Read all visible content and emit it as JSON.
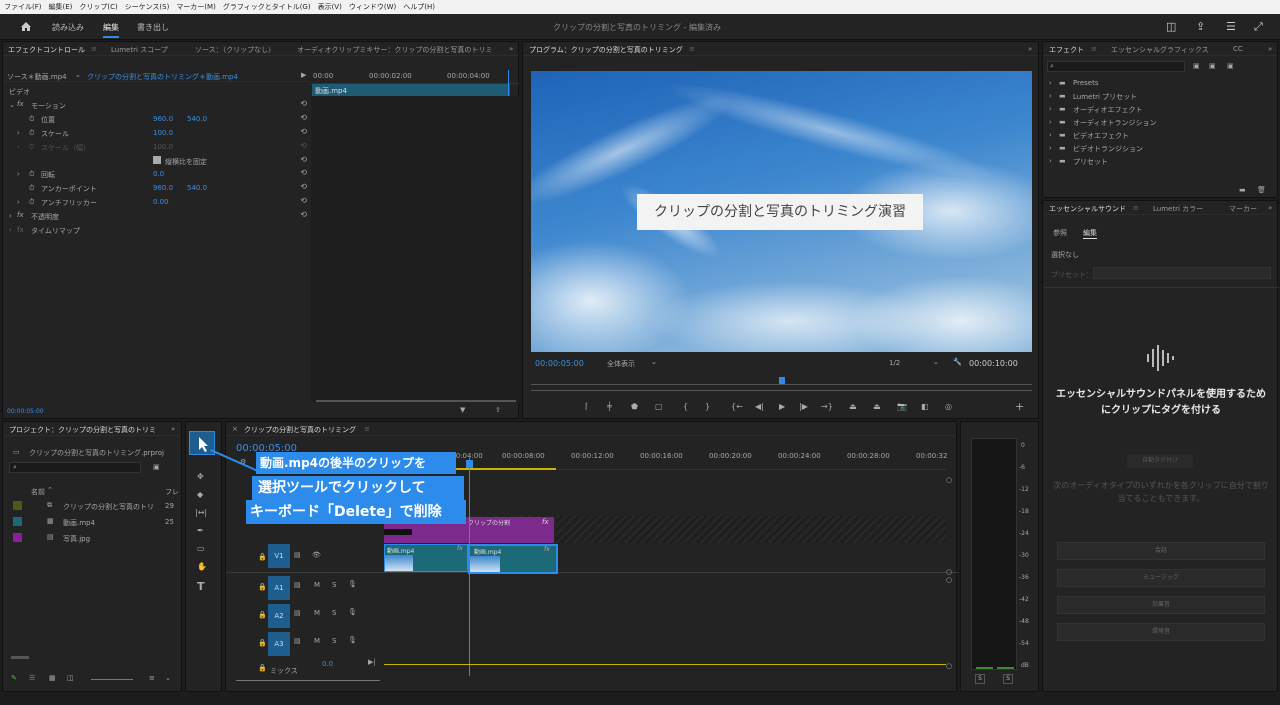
{
  "menu": [
    "ファイル(F)",
    "編集(E)",
    "クリップ(C)",
    "シーケンス(S)",
    "マーカー(M)",
    "グラフィックとタイトル(G)",
    "表示(V)",
    "ウィンドウ(W)",
    "ヘルプ(H)"
  ],
  "workspaces": {
    "home_icon": "home-icon",
    "import": "読み込み",
    "edit": "編集",
    "export": "書き出し"
  },
  "window_title": "クリップの分割と写真のトリミング - 編集済み",
  "effect_controls": {
    "tabs": [
      "エフェクトコントロール",
      "Lumetri スコープ",
      "ソース：（クリップなし）",
      "オーディオクリップミキサー：クリップの分割と写真のトリミ"
    ],
    "source_row": "ソース＊動画.mp4",
    "sequence_row": "クリップの分割と写真のトリミング＊動画.mp4",
    "video_label": "ビデオ",
    "ruler": [
      "00:00",
      "00:00:02:00",
      "00:00:04:00"
    ],
    "clip_label": "動画.mp4",
    "motion": "モーション",
    "position_label": "位置",
    "position_x": "960.0",
    "position_y": "540.0",
    "scale_label": "スケール",
    "scale_value": "100.0",
    "scale_w_label": "スケール（幅）",
    "scale_w_value": "100.0",
    "uniform_scale": "縦横比を固定",
    "rotation_label": "回転",
    "rotation_value": "0.0",
    "anchor_label": "アンカーポイント",
    "anchor_x": "960.0",
    "anchor_y": "540.0",
    "antiflicker_label": "アンチフリッカー",
    "antiflicker_value": "0.00",
    "opacity": "不透明度",
    "time_remap": "タイムリマップ",
    "timecode": "00:00:05:00"
  },
  "program": {
    "tab": "プログラム：クリップの分割と写真のトリミング",
    "title_overlay": "クリップの分割と写真のトリミング演習",
    "timecode": "00:00:05:00",
    "fit": "全体表示",
    "quality": "1/2",
    "duration": "00:00:10:00"
  },
  "effects": {
    "tabs": [
      "エフェクト",
      "エッセンシャルグラフィックス",
      "CC"
    ],
    "items": [
      "Presets",
      "Lumetri プリセット",
      "オーディオエフェクト",
      "オーディオトランジション",
      "ビデオエフェクト",
      "ビデオトランジション",
      "プリセット"
    ]
  },
  "essential_sound": {
    "tabs": [
      "エッセンシャルサウンド",
      "Lumetri カラー",
      "マーカー"
    ],
    "subtabs": [
      "参照",
      "編集"
    ],
    "no_selection": "選択なし",
    "preset_label": "プリセット：",
    "headline": "エッセンシャルサウンドパネルを使用するためにクリップにタグを付ける",
    "auto_match": "自動タグ付け",
    "hint": "次のオーディオタイプのいずれかを各クリップに自分で割り当てることもできます。",
    "buttons": [
      "会話",
      "ミュージック",
      "効果音",
      "環境音"
    ]
  },
  "project": {
    "tab": "プロジェクト：クリップの分割と写真のトリミ",
    "file": "クリップの分割と写真のトリミング.prproj",
    "col_name": "名前",
    "col_fps": "フレ",
    "items": [
      {
        "name": "クリップの分割と写真のトリ",
        "fps": "29",
        "color": "#4d5a16"
      },
      {
        "name": "動画.mp4",
        "fps": "25",
        "color": "#1c6a78"
      },
      {
        "name": "写真.jpg",
        "fps": "",
        "color": "#8a1f9a"
      }
    ]
  },
  "timeline": {
    "tab": "クリップの分割と写真のトリミング",
    "timecode": "00:00:05:00",
    "ruler": [
      "00:00:04:00",
      "00:00:08:00",
      "00:00:12:00",
      "00:00:16:00",
      "00:00:20:00",
      "00:00:24:00",
      "00:00:28:00",
      "00:00:32"
    ],
    "tracks_video": [
      "V1"
    ],
    "tracks_audio": [
      "A1",
      "A2",
      "A3"
    ],
    "mix_label": "ミックス",
    "mix_value": "0.0",
    "clip_title": "クリップの分割",
    "clip_a": "動画.mp4",
    "clip_b": "動画.mp4",
    "fx": "fx"
  },
  "callout": {
    "line1": "動画.mp4の後半のクリップを",
    "line2": "選択ツールでクリックして",
    "line3": "キーボード「Delete」で削除"
  },
  "meter": {
    "scale": [
      "0",
      "-6",
      "-12",
      "-18",
      "-24",
      "-30",
      "-36",
      "-42",
      "-48",
      "-54",
      "dB"
    ],
    "solo": [
      "S",
      "S"
    ]
  },
  "colors": {
    "accent": "#2d8ceb",
    "purple": "#7c2a8c",
    "teal": "#1e5e8e"
  }
}
